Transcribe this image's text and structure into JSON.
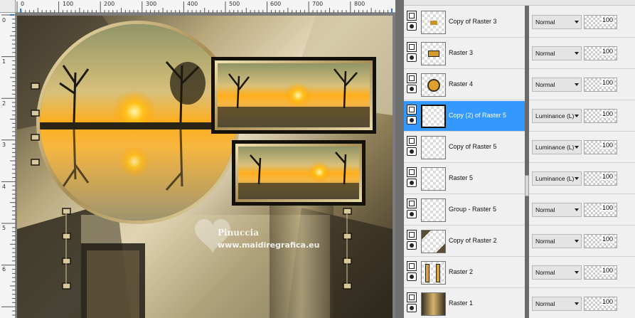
{
  "ruler": {
    "x_ticks": [
      "0",
      "100",
      "200",
      "300",
      "400",
      "500",
      "600",
      "700",
      "800"
    ],
    "y_ticks": [
      "0",
      "1",
      "2",
      "3",
      "4",
      "5",
      "6"
    ]
  },
  "watermark": {
    "name": "Pinuccia",
    "url": "www.maidiregrafica.eu"
  },
  "layers": [
    {
      "name": "Copy of Raster 3",
      "blend": "Normal",
      "opacity": "100",
      "selected": false
    },
    {
      "name": "Raster 3",
      "blend": "Normal",
      "opacity": "100",
      "selected": false
    },
    {
      "name": "Raster 4",
      "blend": "Normal",
      "opacity": "100",
      "selected": false
    },
    {
      "name": "Copy (2) of Raster 5",
      "blend": "Luminance (L)",
      "opacity": "100",
      "selected": true
    },
    {
      "name": "Copy of Raster 5",
      "blend": "Luminance (L)",
      "opacity": "100",
      "selected": false
    },
    {
      "name": "Raster 5",
      "blend": "Luminance (L)",
      "opacity": "100",
      "selected": false
    },
    {
      "name": "Group - Raster 5",
      "blend": "Normal",
      "opacity": "100",
      "selected": false
    },
    {
      "name": "Copy of Raster 2",
      "blend": "Normal",
      "opacity": "100",
      "selected": false
    },
    {
      "name": "Raster 2",
      "blend": "Normal",
      "opacity": "100",
      "selected": false
    },
    {
      "name": "Raster 1",
      "blend": "Normal",
      "opacity": "100",
      "selected": false
    }
  ],
  "colors": {
    "selected_row": "#3399ff",
    "panel_bg": "#f0f0f0",
    "workspace_bg": "#7d7d7d"
  }
}
